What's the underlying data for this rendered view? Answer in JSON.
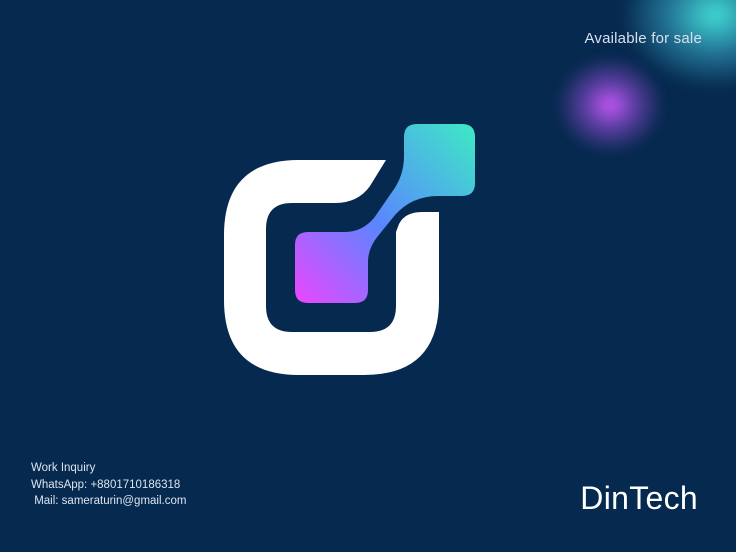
{
  "header": {
    "status_text": "Available for sale"
  },
  "logo": {
    "icon": "dintech-logo-mark",
    "colors": {
      "ring": "#ffffff",
      "gradient_pink": "#e848ff",
      "gradient_blue": "#4a86ff",
      "gradient_cyan": "#3ee6c8",
      "background": "#06294f"
    }
  },
  "contact": {
    "heading": "Work Inquiry",
    "whatsapp": "WhatsApp: +8801710186318",
    "mail": " Mail: sameraturin@gmail.com"
  },
  "brand": {
    "name": "DinTech"
  }
}
